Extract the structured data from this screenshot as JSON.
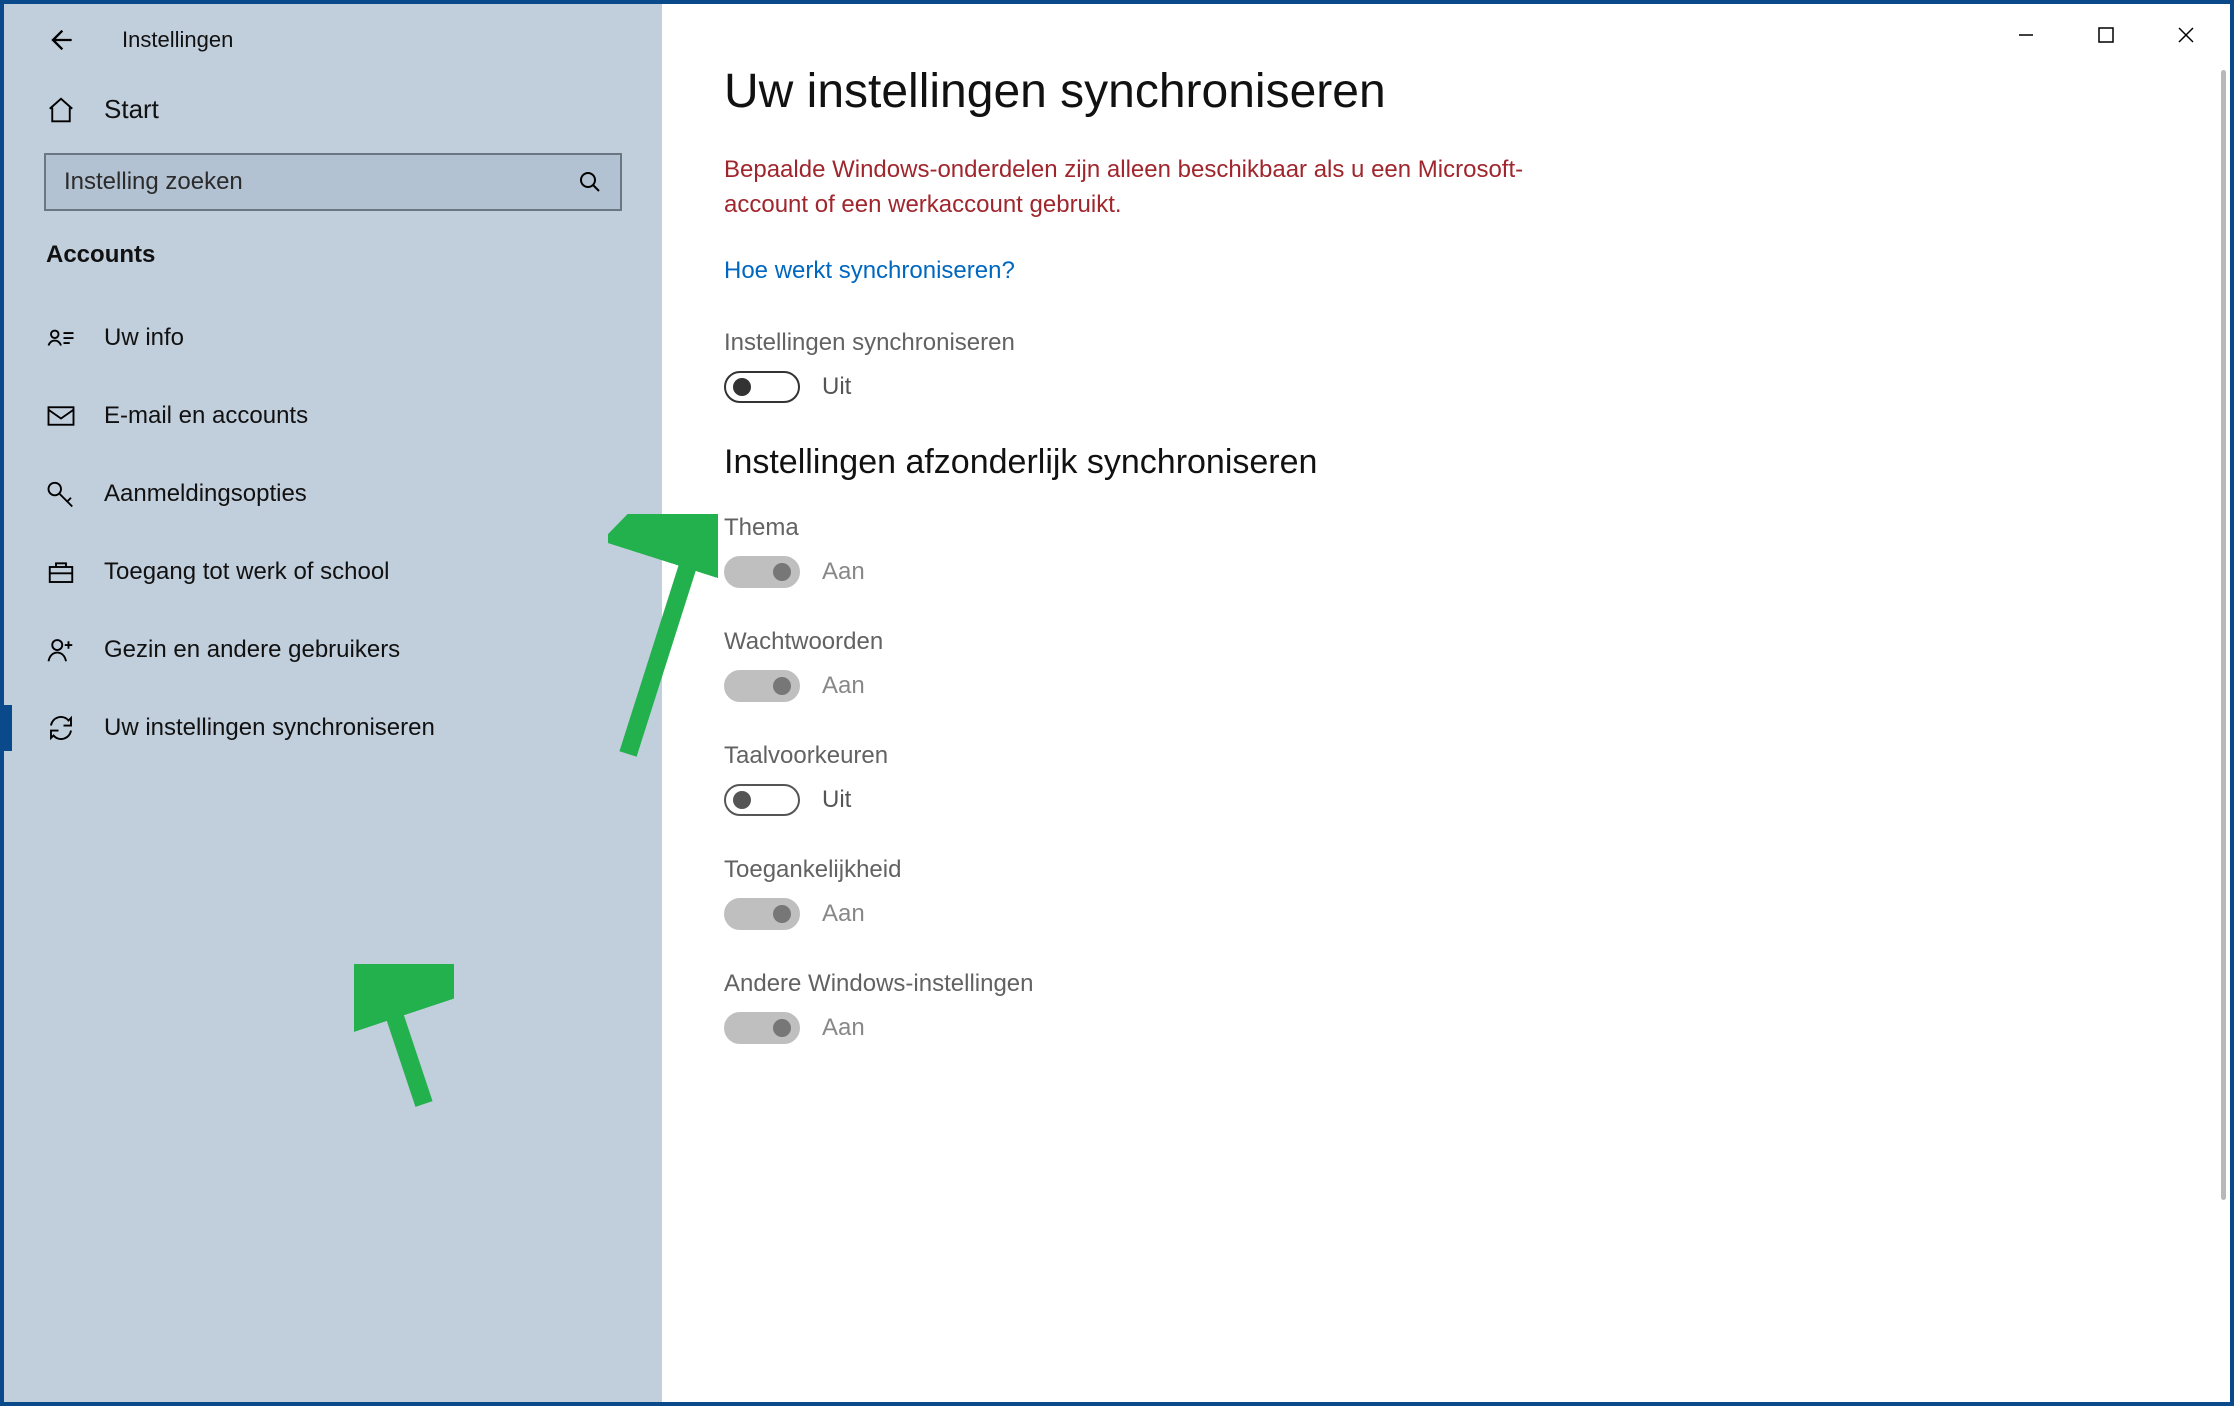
{
  "window": {
    "title": "Instellingen"
  },
  "sidebar": {
    "home": "Start",
    "search_placeholder": "Instelling zoeken",
    "section": "Accounts",
    "items": [
      {
        "label": "Uw info"
      },
      {
        "label": "E-mail en accounts"
      },
      {
        "label": "Aanmeldingsopties"
      },
      {
        "label": "Toegang tot werk of school"
      },
      {
        "label": "Gezin en andere gebruikers"
      },
      {
        "label": "Uw instellingen synchroniseren"
      }
    ]
  },
  "main": {
    "title": "Uw instellingen synchroniseren",
    "warning": "Bepaalde Windows-onderdelen zijn alleen beschikbaar als u een Microsoft-account of een werkaccount gebruikt.",
    "help_link": "Hoe werkt synchroniseren?",
    "sync_master": {
      "label": "Instellingen synchroniseren",
      "state": "Uit"
    },
    "individual_heading": "Instellingen afzonderlijk synchroniseren",
    "individual": [
      {
        "label": "Thema",
        "state": "Aan"
      },
      {
        "label": "Wachtwoorden",
        "state": "Aan"
      },
      {
        "label": "Taalvoorkeuren",
        "state": "Uit"
      },
      {
        "label": "Toegankelijkheid",
        "state": "Aan"
      },
      {
        "label": "Andere Windows-instellingen",
        "state": "Aan"
      }
    ]
  }
}
